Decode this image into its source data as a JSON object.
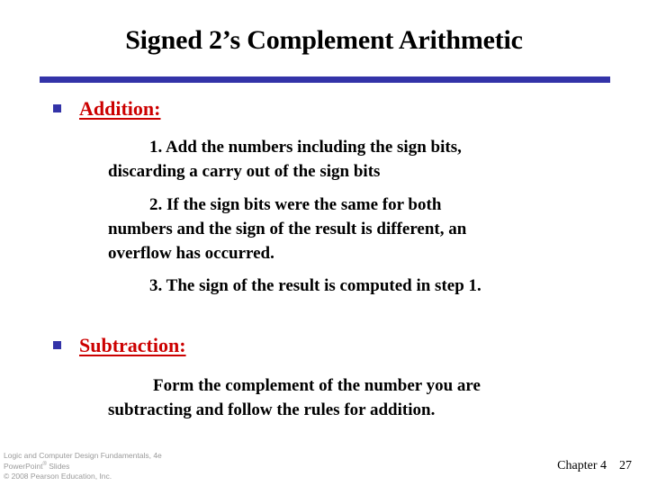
{
  "slide": {
    "title": "Signed 2’s Complement Arithmetic",
    "accent_color": "#3333a8",
    "heading_color": "#cc0000",
    "body_color": "#000000",
    "background_color": "#ffffff",
    "bullet_icon": "square-bullet"
  },
  "sections": [
    {
      "heading": "Addition:",
      "items": [
        {
          "lines": [
            "1. Add the numbers including the sign bits,",
            "discarding a carry out of the sign bits"
          ]
        },
        {
          "lines": [
            "2. If the sign bits were the same for both",
            "numbers and the sign of the result is different, an",
            "overflow has occurred."
          ]
        },
        {
          "lines": [
            "3. The sign of the result is computed in step 1."
          ]
        }
      ]
    },
    {
      "heading": "Subtraction:",
      "items": [
        {
          "lines": [
            "Form the complement of the number you are",
            "subtracting and follow the rules for addition."
          ]
        }
      ]
    }
  ],
  "footer": {
    "credit_line1": "Logic and Computer Design Fundamentals, 4e",
    "credit_line2_pre": "PowerPoint",
    "credit_line2_mark": "®",
    "credit_line2_post": " Slides",
    "credit_line3": "© 2008 Pearson Education, Inc.",
    "chapter": "Chapter 4",
    "page_number": "27"
  }
}
